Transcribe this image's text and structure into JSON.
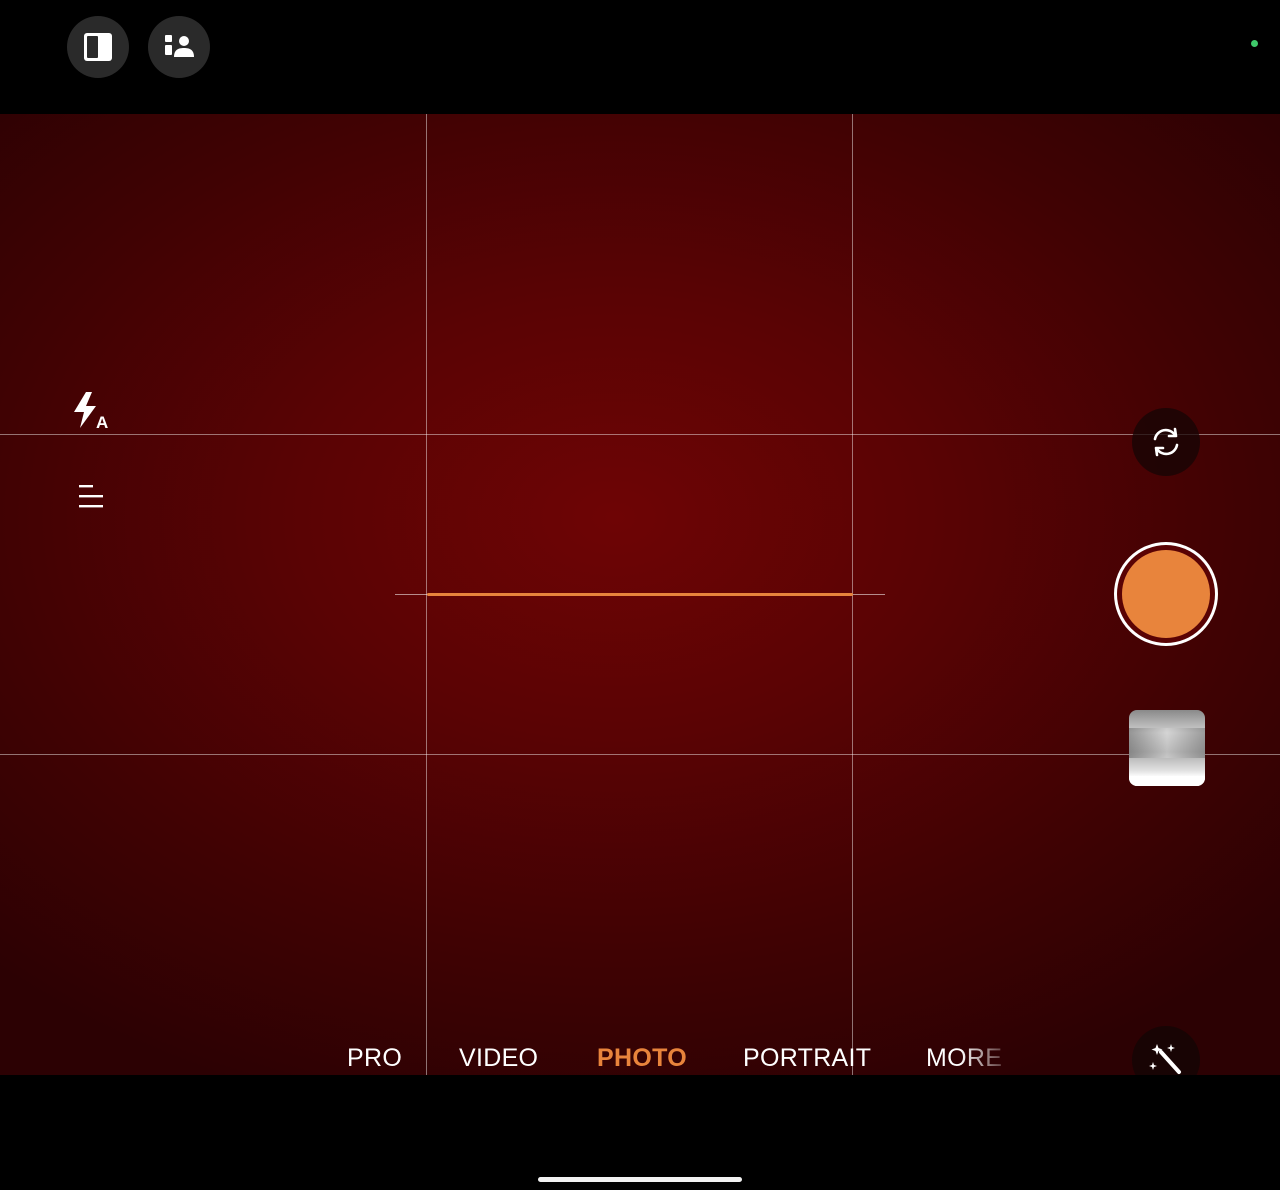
{
  "colors": {
    "accent": "#e8843c",
    "status_dot": "#3ec96a"
  },
  "top_bar": {
    "buttons": [
      {
        "icon": "split-screen-icon"
      },
      {
        "icon": "person-icon"
      }
    ]
  },
  "left_controls": {
    "flash": {
      "icon": "flash-auto-icon",
      "badge": "A"
    },
    "settings": {
      "icon": "menu-icon"
    }
  },
  "right_controls": {
    "flip": {
      "icon": "switch-camera-icon"
    },
    "shutter": {
      "icon": "shutter-button"
    },
    "gallery": {
      "icon": "gallery-thumbnail"
    },
    "magic": {
      "icon": "magic-wand-icon"
    }
  },
  "modes": [
    {
      "label": "PRO",
      "active": false
    },
    {
      "label": "VIDEO",
      "active": false
    },
    {
      "label": "PHOTO",
      "active": true
    },
    {
      "label": "PORTRAIT",
      "active": false
    },
    {
      "label": "MORE",
      "active": false
    }
  ]
}
